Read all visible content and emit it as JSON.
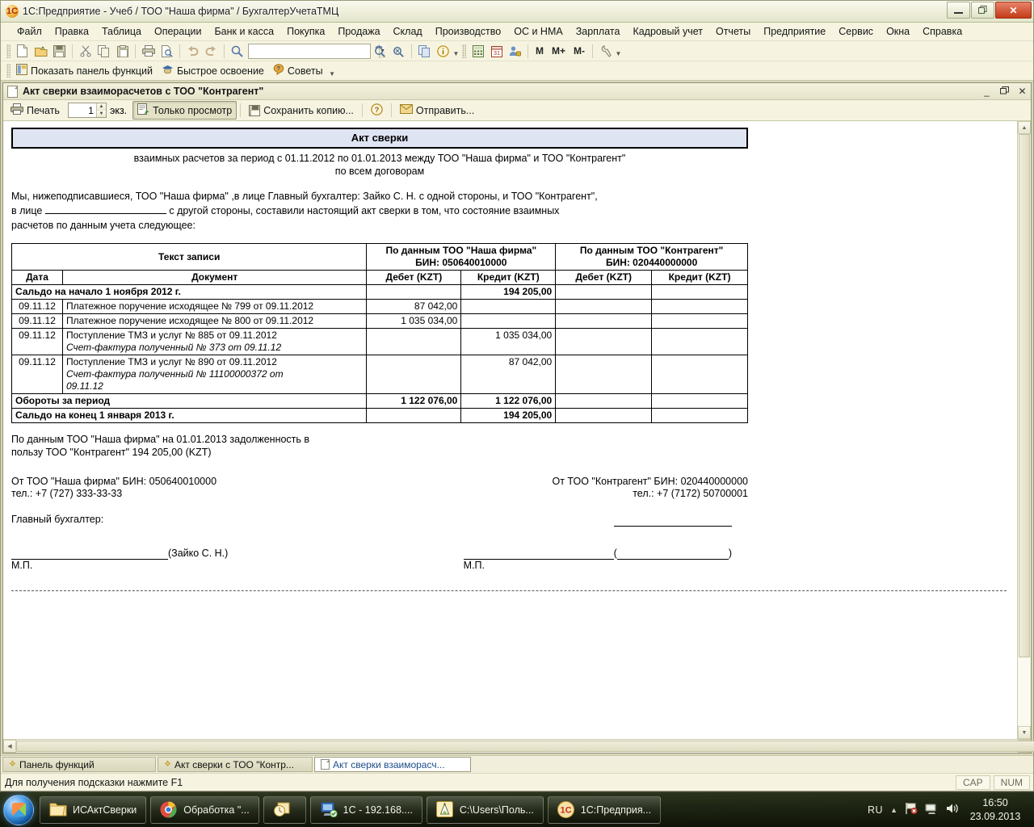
{
  "window": {
    "title": "1С:Предприятие - Учеб / ТОО \"Наша фирма\" / БухгалтерУчетаТМЦ",
    "minimize": "—",
    "restore": "❐",
    "close": "✕"
  },
  "menu": [
    {
      "label": "Файл",
      "accel": "Ф"
    },
    {
      "label": "Правка",
      "accel": "П"
    },
    {
      "label": "Таблица",
      "accel": ""
    },
    {
      "label": "Операции",
      "accel": ""
    },
    {
      "label": "Банк и касса",
      "accel": ""
    },
    {
      "label": "Покупка",
      "accel": ""
    },
    {
      "label": "Продажа",
      "accel": ""
    },
    {
      "label": "Склад",
      "accel": ""
    },
    {
      "label": "Производство",
      "accel": ""
    },
    {
      "label": "ОС и НМА",
      "accel": ""
    },
    {
      "label": "Зарплата",
      "accel": ""
    },
    {
      "label": "Кадровый учет",
      "accel": ""
    },
    {
      "label": "Отчеты",
      "accel": ""
    },
    {
      "label": "Предприятие",
      "accel": ""
    },
    {
      "label": "Сервис",
      "accel": "С"
    },
    {
      "label": "Окна",
      "accel": "О"
    },
    {
      "label": "Справка",
      "accel": ""
    }
  ],
  "toolbar": {
    "search_value": "",
    "search_placeholder": "",
    "buttons": [
      {
        "name": "new-document-icon",
        "label": ""
      },
      {
        "name": "open-document-icon",
        "label": ""
      },
      {
        "name": "save-icon",
        "label": ""
      },
      {
        "name": "cut-icon",
        "label": ""
      },
      {
        "name": "copy-icon",
        "label": ""
      },
      {
        "name": "paste-icon",
        "label": ""
      },
      {
        "name": "print-icon",
        "label": ""
      },
      {
        "name": "print-preview-icon",
        "label": ""
      },
      {
        "name": "undo-icon",
        "label": ""
      },
      {
        "name": "redo-icon",
        "label": ""
      },
      {
        "name": "find-icon",
        "label": ""
      },
      {
        "name": "refresh-search-icon",
        "label": ""
      },
      {
        "name": "cancel-search-icon",
        "label": ""
      },
      {
        "name": "copy-rows-icon",
        "label": ""
      },
      {
        "name": "info-icon",
        "label": ""
      },
      {
        "name": "calculator-icon",
        "label": ""
      },
      {
        "name": "calendar-icon",
        "label": ""
      },
      {
        "name": "user-settings-icon",
        "label": ""
      }
    ],
    "memory_buttons": [
      "M",
      "M+",
      "M-"
    ],
    "settings_icon": "wrench-icon"
  },
  "toolbar2": {
    "items": [
      {
        "name": "show-functions-panel-button",
        "label": "Показать панель функций",
        "icon": "panel-icon"
      },
      {
        "name": "quick-start-button",
        "label": "Быстрое освоение",
        "icon": "graduation-icon"
      },
      {
        "name": "tips-button",
        "label": "Советы",
        "icon": "tips-icon"
      }
    ]
  },
  "doc_window": {
    "title": "Акт сверки взаимора��четов с ТОО \"Контрагент\"",
    "title_text": "Акт сверки взаиморасчетов с ТОО \"Контрагент\"",
    "minimize": "_",
    "restore": "❐",
    "close": "✕",
    "toolbar": {
      "print_label": "Печать",
      "copies_value": "1",
      "copies_unit": "экз.",
      "view_only_label": "Только просмотр",
      "save_copy_label": "Сохранить копию...",
      "help_label": "?",
      "send_label": "Отправить..."
    }
  },
  "report": {
    "title": "Акт сверки",
    "subtitle_1": "взаимных расчетов за период с 01.11.2012 по 01.01.2013 между ТОО \"Наша фирма\" и ТОО \"Контрагент\"",
    "subtitle_2": "по всем договорам",
    "intro_line_1_a": "Мы, нижеподписавшиеся, ТОО \"Наша фирма\" ,в лице Главный бухгалтер: Зайко С. Н. с одной стороны, и ТОО \"Контрагент\",",
    "intro_line_2_a": "в лице",
    "intro_line_2_b": "с другой стороны, составили настоящий акт сверки в том, что состояние взаимных",
    "intro_line_3": "расчетов по данным учета следующее:",
    "table": {
      "group_headers": {
        "text_record": "Текст записи",
        "our_firm_line1": "По  данным ТОО \"Наша фирма\"",
        "our_firm_line2": "БИН:  050640010000",
        "counterparty_line1": "По  данным ТОО \"Контрагент\"",
        "counterparty_line2": "БИН: 020440000000"
      },
      "sub_headers": {
        "date": "Дата",
        "document": "Документ",
        "debit_1": "Дебет (KZT)",
        "credit_1": "Кредит (KZT)",
        "debit_2": "Дебет (KZT)",
        "credit_2": "Кредит (KZT)"
      },
      "rows": [
        {
          "kind": "total",
          "date": "",
          "document": "Сальдо на начало 1 ноября 2012 г.",
          "note": "",
          "debit_1": "",
          "credit_1": "194 205,00",
          "debit_2": "",
          "credit_2": ""
        },
        {
          "kind": "item",
          "date": "09.11.12",
          "document": "Платежное поручение исходящее № 799 от 09.11.2012",
          "note": "",
          "debit_1": "87 042,00",
          "credit_1": "",
          "debit_2": "",
          "credit_2": ""
        },
        {
          "kind": "item",
          "date": "09.11.12",
          "document": "Платежное поручение исходящее № 800 от 09.11.2012",
          "note": "",
          "debit_1": "1 035 034,00",
          "credit_1": "",
          "debit_2": "",
          "credit_2": ""
        },
        {
          "kind": "item",
          "date": "09.11.12",
          "document": "Поступление ТМЗ и услуг № 885 от 09.11.2012",
          "note": "Счет-фактура полученный № 373 от 09.11.12",
          "debit_1": "",
          "credit_1": "1 035 034,00",
          "debit_2": "",
          "credit_2": ""
        },
        {
          "kind": "item",
          "date": "09.11.12",
          "document": "Поступление ТМЗ и услуг № 890 от 09.11.2012",
          "note": "Счет-фактура полученный № 11100000372 от 09.11.12",
          "debit_1": "",
          "credit_1": "87 042,00",
          "debit_2": "",
          "credit_2": ""
        },
        {
          "kind": "total",
          "date": "",
          "document": "Обороты за период",
          "note": "",
          "debit_1": "1 122 076,00",
          "credit_1": "1 122 076,00",
          "debit_2": "",
          "credit_2": ""
        },
        {
          "kind": "total",
          "date": "",
          "document": "Сальдо на конец 1 января 2013 г.",
          "note": "",
          "debit_1": "",
          "credit_1": "194 205,00",
          "debit_2": "",
          "credit_2": ""
        }
      ]
    },
    "summary_line_1": "По данным ТОО \"Наша фирма\" на 01.01.2013 задолженность в",
    "summary_line_2": "пользу ТОО \"Контрагент\"  194 205,00 (KZT)",
    "party_left_line1": "От ТОО \"Наша фирма\" БИН: 050640010000",
    "party_left_line2": "тел.: +7 (727) 333-33-33",
    "party_right_line1": "От ТОО \"Контрагент\" БИН: 020440000000",
    "party_right_line2": "тел.: +7 (7172) 50700001",
    "chief_accountant_label": "Главный бухгалтер:",
    "sign_left_name": "(Зайко С. Н.)",
    "sign_right_open": "(",
    "sign_right_close": ")",
    "stamp_left": "М.П.",
    "stamp_right": "М.П."
  },
  "window_tabs": [
    {
      "label": "Панель функций",
      "icon": "window-icon",
      "active": false
    },
    {
      "label": "Акт сверки с ТОО \"Контр...",
      "icon": "window-icon",
      "active": false
    },
    {
      "label": "Акт сверки взаиморасч...",
      "icon": "document-icon",
      "active": true
    }
  ],
  "statusbar": {
    "hint": "Для получения подсказки нажмите F1",
    "caps": "CAP",
    "num": "NUM"
  },
  "taskbar": {
    "start": "start-orb",
    "tasks": [
      {
        "label": "ИСАктСверки",
        "icon": "folder-icon"
      },
      {
        "label": "Обработка \"...",
        "icon": "chrome-icon"
      },
      {
        "label": "",
        "icon": "outlook-icon"
      },
      {
        "label": "1C - 192.168....",
        "icon": "remote-desktop-icon"
      },
      {
        "label": "C:\\Users\\Поль...",
        "icon": "compass-icon"
      },
      {
        "label": "1С:Предприя...",
        "icon": "onec-icon"
      }
    ],
    "tray": {
      "language": "RU",
      "show_hidden": "▲",
      "flag_icon": "flag-icon",
      "network_icon": "network-icon",
      "volume_icon": "volume-icon"
    },
    "clock_time": "16:50",
    "clock_date": "23.09.2013"
  }
}
